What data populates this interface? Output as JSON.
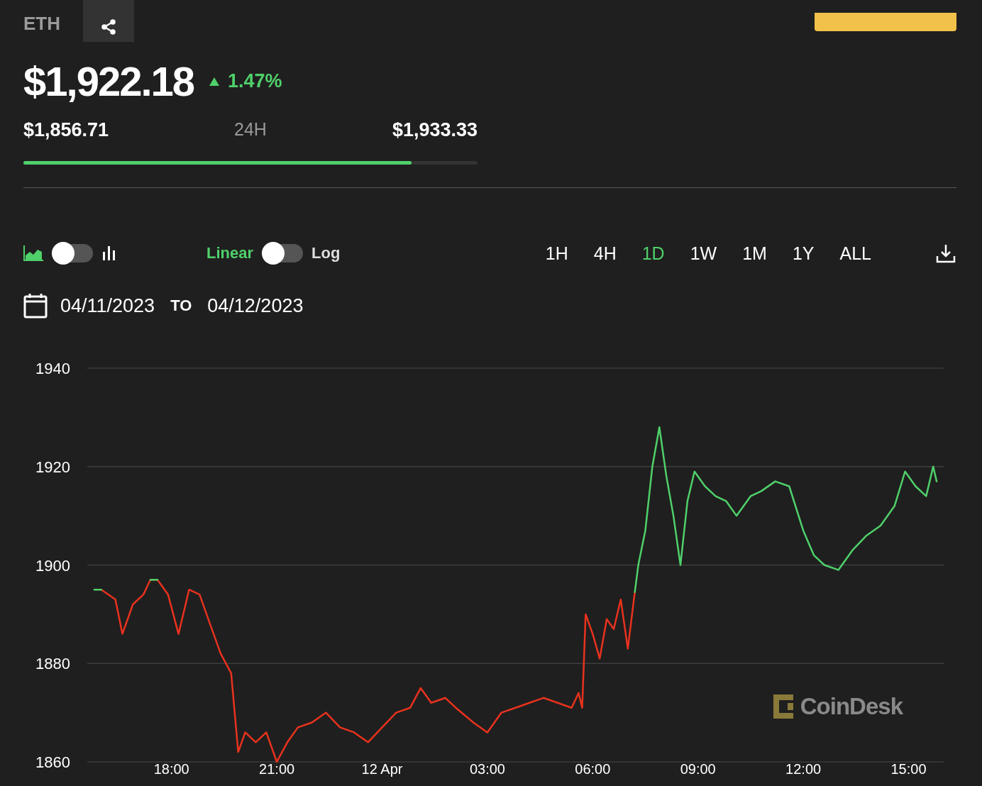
{
  "header": {
    "symbol": "ETH",
    "price": "$1,922.18",
    "change": "1.47%"
  },
  "range": {
    "low": "$1,856.71",
    "period": "24H",
    "high": "$1,933.33",
    "level": 0.854
  },
  "controls": {
    "chart_toggle": {
      "on": false
    },
    "scale_toggle": {
      "on": false,
      "off_label": "Linear",
      "on_label": "Log"
    },
    "periods": [
      {
        "label": "1H",
        "selected": false
      },
      {
        "label": "4H",
        "selected": false
      },
      {
        "label": "1D",
        "selected": true
      },
      {
        "label": "1W",
        "selected": false
      },
      {
        "label": "1M",
        "selected": false
      },
      {
        "label": "1Y",
        "selected": false
      },
      {
        "label": "ALL",
        "selected": false
      }
    ]
  },
  "dates": {
    "from": "04/11/2023",
    "separator": "TO",
    "to": "04/12/2023"
  },
  "chart": {
    "brand": "CoinDesk",
    "chart_data": {
      "type": "line",
      "grid": true,
      "xlim": [
        "2023-04-11T15:36",
        "2023-04-12T16:00"
      ],
      "ylim": [
        1860,
        1940
      ],
      "yticks": [
        1860,
        1880,
        1900,
        1920,
        1940
      ],
      "xticks": [
        {
          "value": "2023-04-11T18:00",
          "label": "18:00"
        },
        {
          "value": "2023-04-11T21:00",
          "label": "21:00"
        },
        {
          "value": "2023-04-12T00:00",
          "label": "12 Apr"
        },
        {
          "value": "2023-04-12T03:00",
          "label": "03:00"
        },
        {
          "value": "2023-04-12T06:00",
          "label": "06:00"
        },
        {
          "value": "2023-04-12T09:00",
          "label": "09:00"
        },
        {
          "value": "2023-04-12T12:00",
          "label": "12:00"
        },
        {
          "value": "2023-04-12T15:00",
          "label": "15:00"
        }
      ],
      "x": [
        "2023-04-11T15:48",
        "2023-04-11T16:00",
        "2023-04-11T16:24",
        "2023-04-11T16:36",
        "2023-04-11T16:54",
        "2023-04-11T17:12",
        "2023-04-11T17:24",
        "2023-04-11T17:36",
        "2023-04-11T17:54",
        "2023-04-11T18:12",
        "2023-04-11T18:30",
        "2023-04-11T18:48",
        "2023-04-11T19:06",
        "2023-04-11T19:24",
        "2023-04-11T19:42",
        "2023-04-11T19:54",
        "2023-04-11T20:06",
        "2023-04-11T20:24",
        "2023-04-11T20:42",
        "2023-04-11T21:00",
        "2023-04-11T21:18",
        "2023-04-11T21:36",
        "2023-04-11T22:00",
        "2023-04-11T22:24",
        "2023-04-11T22:48",
        "2023-04-11T23:12",
        "2023-04-11T23:36",
        "2023-04-12T00:00",
        "2023-04-12T00:24",
        "2023-04-12T00:48",
        "2023-04-12T01:06",
        "2023-04-12T01:24",
        "2023-04-12T01:48",
        "2023-04-12T02:06",
        "2023-04-12T02:36",
        "2023-04-12T03:00",
        "2023-04-12T03:24",
        "2023-04-12T03:48",
        "2023-04-12T04:12",
        "2023-04-12T04:36",
        "2023-04-12T05:00",
        "2023-04-12T05:24",
        "2023-04-12T05:36",
        "2023-04-12T05:42",
        "2023-04-12T05:48",
        "2023-04-12T06:00",
        "2023-04-12T06:12",
        "2023-04-12T06:24",
        "2023-04-12T06:36",
        "2023-04-12T06:48",
        "2023-04-12T07:00",
        "2023-04-12T07:12",
        "2023-04-12T07:18",
        "2023-04-12T07:30",
        "2023-04-12T07:42",
        "2023-04-12T07:54",
        "2023-04-12T08:06",
        "2023-04-12T08:18",
        "2023-04-12T08:30",
        "2023-04-12T08:42",
        "2023-04-12T08:54",
        "2023-04-12T09:12",
        "2023-04-12T09:30",
        "2023-04-12T09:48",
        "2023-04-12T10:06",
        "2023-04-12T10:30",
        "2023-04-12T10:48",
        "2023-04-12T11:12",
        "2023-04-12T11:36",
        "2023-04-12T12:00",
        "2023-04-12T12:18",
        "2023-04-12T12:36",
        "2023-04-12T13:00",
        "2023-04-12T13:24",
        "2023-04-12T13:48",
        "2023-04-12T14:12",
        "2023-04-12T14:36",
        "2023-04-12T14:54",
        "2023-04-12T15:12",
        "2023-04-12T15:30",
        "2023-04-12T15:42",
        "2023-04-12T15:48"
      ],
      "series": [
        {
          "color": "#4fd06a",
          "values": [
            1895,
            1895,
            null,
            null,
            null,
            null,
            1897,
            1897,
            null,
            null,
            null,
            null,
            null,
            null,
            null,
            null,
            null,
            null,
            null,
            null,
            null,
            null,
            null,
            null,
            null,
            null,
            null,
            null,
            null,
            null,
            null,
            null,
            null,
            null,
            null,
            null,
            null,
            null,
            null,
            null,
            null,
            null,
            null,
            null,
            null,
            null,
            null,
            null,
            null,
            null,
            null,
            1894.5,
            1900,
            1907,
            1920,
            1928,
            1918,
            1910,
            1900,
            1913,
            1919,
            1916,
            1914,
            1913,
            1910,
            1914,
            1915,
            1917,
            1916,
            1907,
            1902,
            1900,
            1899,
            1903,
            1906,
            1908,
            1912,
            1919,
            1916,
            1914,
            1920,
            1917
          ]
        },
        {
          "color": "#e8321e",
          "values": [
            null,
            1895,
            1893,
            1886,
            1892,
            1894,
            1897,
            1897,
            1894,
            1886,
            1895,
            1894,
            1888,
            1882,
            1878,
            1862,
            1866,
            1864,
            1866,
            1860,
            1864,
            1867,
            1868,
            1870,
            1867,
            1866,
            1864,
            1867,
            1870,
            1871,
            1875,
            1872,
            1873,
            1871,
            1868,
            1866,
            1870,
            1871,
            1872,
            1873,
            1872,
            1871,
            1874,
            1871,
            1890,
            1886,
            1881,
            1889,
            1887,
            1893,
            1883,
            1894.5,
            null,
            null,
            null,
            null,
            null,
            null,
            null,
            null,
            null,
            null,
            null,
            null,
            null,
            null,
            null,
            null,
            null,
            null,
            null,
            null,
            null,
            null,
            null,
            null,
            null,
            null,
            null,
            null,
            null,
            null
          ]
        }
      ]
    }
  }
}
